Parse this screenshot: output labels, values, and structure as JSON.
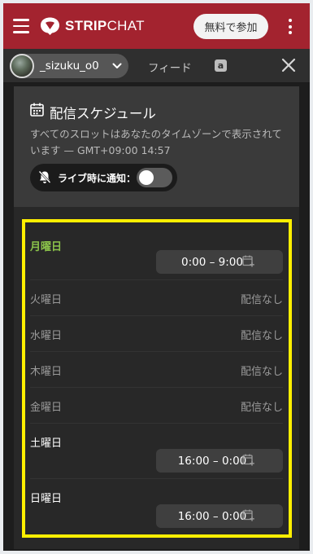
{
  "topbar": {
    "logo_strong": "STRIP",
    "logo_light": "CHAT",
    "join_label": "無料で参加"
  },
  "subbar": {
    "username": "_sizuku_o0",
    "feed_label": "フィード",
    "amazon_glyph": "a"
  },
  "schedule": {
    "title": "配信スケジュール",
    "description": "すべてのスロットはあなたのタイムゾーンで表示されています — GMT+09:00 14:57",
    "notify_label": "ライブ時に通知：",
    "notify_on": false,
    "days": [
      {
        "name": "月曜日",
        "slot": "0:00 – 9:00",
        "state": "today"
      },
      {
        "name": "火曜日",
        "none_label": "配信なし"
      },
      {
        "name": "水曜日",
        "none_label": "配信なし"
      },
      {
        "name": "木曜日",
        "none_label": "配信なし"
      },
      {
        "name": "金曜日",
        "none_label": "配信なし"
      },
      {
        "name": "土曜日",
        "slot": "16:00 – 0:00"
      },
      {
        "name": "日曜日",
        "slot": "16:00 – 0:00"
      }
    ]
  },
  "colors": {
    "brand_red": "#a3232f",
    "today_green": "#8bc34a",
    "highlight_yellow": "#ffef00"
  }
}
